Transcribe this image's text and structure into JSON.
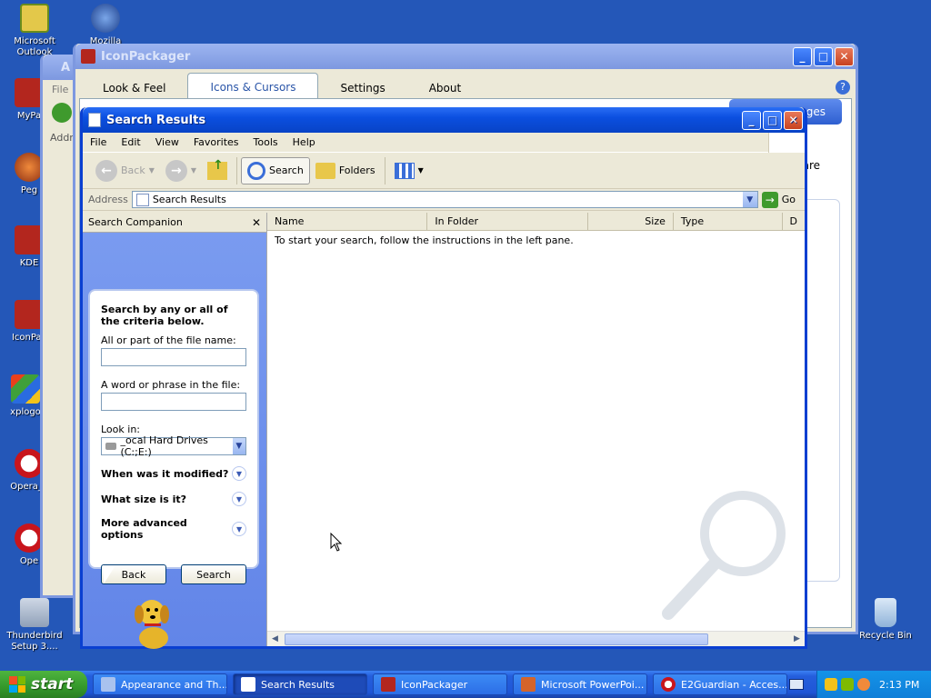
{
  "desktop": {
    "icons": [
      {
        "label": "Microsoft Outlook"
      },
      {
        "label": "Mozilla"
      },
      {
        "label": "MyPa"
      },
      {
        "label": "Peg"
      },
      {
        "label": "KDE"
      },
      {
        "label": "IconPac"
      },
      {
        "label": "xplogo"
      },
      {
        "label": "Opera_v"
      },
      {
        "label": "Ope"
      },
      {
        "label": "Thunderbird Setup 3...."
      },
      {
        "label": "Recycle Bin"
      }
    ]
  },
  "appearance_window": {
    "title": "A",
    "menu_file": "File",
    "address": "Addre"
  },
  "iconpackager": {
    "title": "IconPackager",
    "tabs": [
      "Look & Feel",
      "Icons & Cursors",
      "Settings",
      "About"
    ],
    "blue_button": "nges",
    "side_text": "are",
    "help_icon": "?"
  },
  "search_window": {
    "title": "Search Results",
    "menu": [
      "File",
      "Edit",
      "View",
      "Favorites",
      "Tools",
      "Help"
    ],
    "toolbar": {
      "back": "Back",
      "search": "Search",
      "folders": "Folders"
    },
    "address_label": "Address",
    "address_value": "Search Results",
    "go_label": "Go",
    "companion_title": "Search Companion",
    "columns": [
      "Name",
      "In Folder",
      "Size",
      "Type",
      "D"
    ],
    "instructions": "To start your search, follow the instructions in the left pane.",
    "panel": {
      "heading": "Search by any or all of the criteria below.",
      "file_name_label": "All or part of the file name:",
      "file_name_value": "",
      "phrase_label": "A word or phrase in the file:",
      "phrase_value": "",
      "look_in_label": "Look in:",
      "look_in_value": "_ocal Hard Drives (C:;E:)",
      "opt_modified": "When was it modified?",
      "opt_size": "What size is it?",
      "opt_advanced": "More advanced options",
      "back_button": "Back",
      "search_button": "Search"
    }
  },
  "taskbar": {
    "start": "start",
    "tasks": [
      {
        "label": "Appearance and Th..."
      },
      {
        "label": "Search Results"
      },
      {
        "label": "IconPackager"
      },
      {
        "label": "Microsoft PowerPoi..."
      },
      {
        "label": "E2Guardian - Acces..."
      }
    ],
    "clock": "2:13 PM"
  }
}
